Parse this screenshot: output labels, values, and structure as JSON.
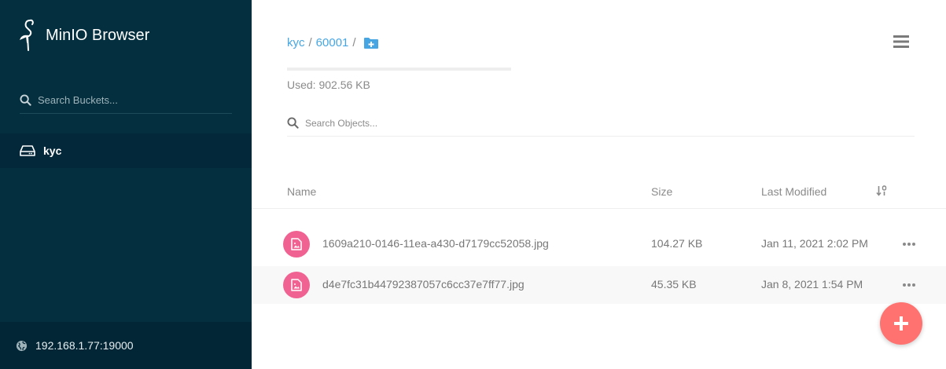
{
  "app": {
    "title": "MinIO Browser"
  },
  "sidebar": {
    "search_placeholder": "Search Buckets...",
    "buckets": [
      {
        "name": "kyc",
        "icon": "drive-icon",
        "selected": true
      }
    ],
    "host": {
      "icon": "globe-icon",
      "address": "192.168.1.77:19000"
    }
  },
  "main": {
    "breadcrumb": [
      {
        "label": "kyc"
      },
      {
        "label": "60001"
      }
    ],
    "separator": "/",
    "usage": {
      "label": "Used: 902.56 KB",
      "fill_fraction": 0.0
    },
    "search_placeholder": "Search Objects...",
    "table": {
      "headers": {
        "name": "Name",
        "size": "Size",
        "modified": "Last Modified"
      },
      "rows": [
        {
          "name": "1609a210-0146-11ea-a430-d7179cc52058.jpg",
          "size": "104.27 KB",
          "modified": "Jan 11, 2021 2:02 PM"
        },
        {
          "name": "d4e7fc31b44792387057c6cc37e7ff77.jpg",
          "size": "45.35 KB",
          "modified": "Jan 8, 2021 1:54 PM"
        }
      ]
    }
  },
  "colors": {
    "sidebar_bg": "#032f3e",
    "link": "#46a6e4",
    "file_icon": "#f06292",
    "fab": "#ff726f"
  },
  "icons": {
    "logo": "minio-bird-icon",
    "add_folder": "folder-plus-icon",
    "menu": "hamburger-menu-icon",
    "sort": "sort-icon",
    "file": "image-file-icon",
    "more": "more-horizontal-icon",
    "fab": "plus-icon"
  }
}
